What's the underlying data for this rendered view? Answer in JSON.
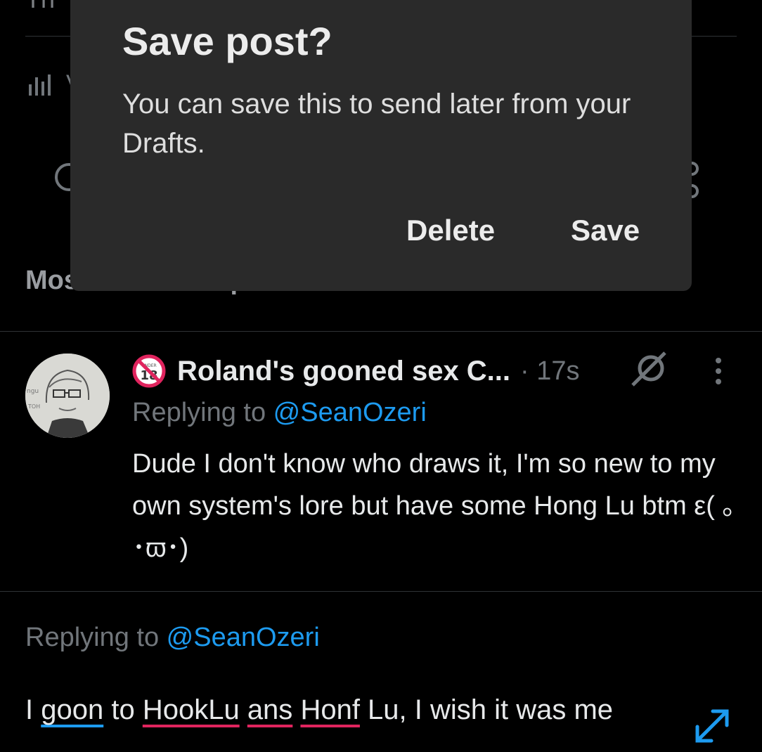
{
  "background": {
    "views_label_partial": "V",
    "section_heading": "Most relevant replies"
  },
  "reply": {
    "badge_label": "UNDER 18",
    "display_name": "Roland's gooned sex C...",
    "timestamp": "· 17s",
    "replying_prefix": "Replying to ",
    "replying_handle": "@SeanOzeri",
    "text": "Dude I don't know who draws it, I'm so new to my own system's lore but have some Hong Lu btm ε( ｡ ･ϖ･)"
  },
  "composer": {
    "replying_prefix": "Replying to ",
    "replying_handle": "@SeanOzeri",
    "text_parts": [
      "I ",
      "goon",
      " to ",
      "HookLu",
      " ",
      "ans",
      " ",
      "Honf",
      " Lu, I wish it was me"
    ]
  },
  "dialog": {
    "title": "Save post?",
    "body": "You can save this to send later from your Drafts.",
    "delete_label": "Delete",
    "save_label": "Save"
  },
  "colors": {
    "background": "#000000",
    "dialog": "#2a2a2a",
    "link": "#1d9bf0",
    "spell_error": "#e0245e"
  },
  "icons": [
    "views-icon",
    "comment-icon",
    "share-icon",
    "under-18-icon",
    "no-symbol-icon",
    "more-vertical-icon",
    "expand-icon"
  ]
}
